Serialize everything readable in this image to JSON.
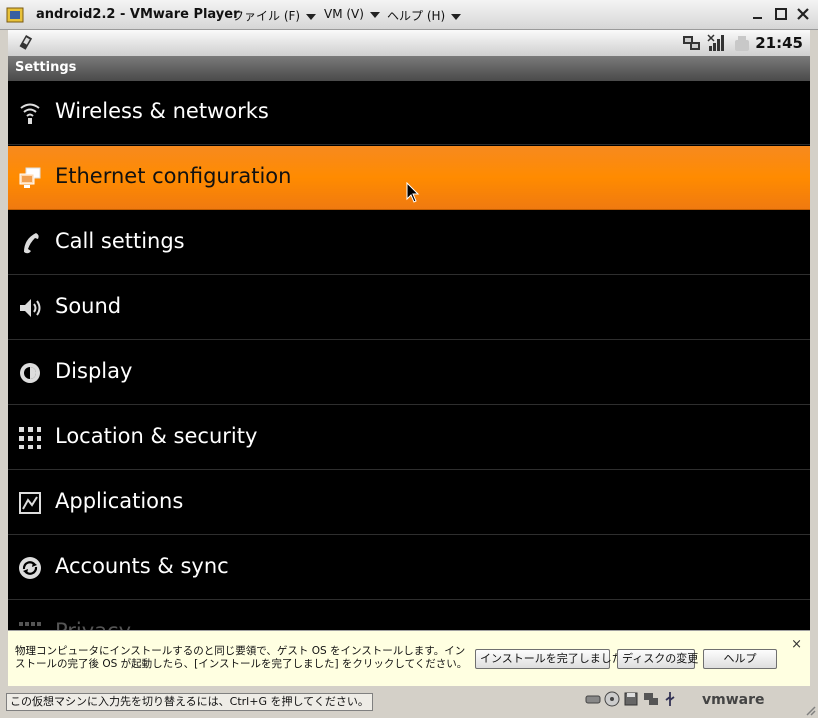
{
  "window": {
    "title": "android2.2 - VMware Player",
    "menus": [
      {
        "label": "ファイル (F)"
      },
      {
        "label": "VM (V)"
      },
      {
        "label": "ヘルプ (H)"
      }
    ]
  },
  "android": {
    "clock": "21:45",
    "header": "Settings",
    "items": [
      {
        "label": "Wireless & networks",
        "icon": "wifi-icon"
      },
      {
        "label": "Ethernet configuration",
        "icon": "ethernet-icon",
        "selected": true
      },
      {
        "label": "Call settings",
        "icon": "phone-icon"
      },
      {
        "label": "Sound",
        "icon": "speaker-icon"
      },
      {
        "label": "Display",
        "icon": "brightness-icon"
      },
      {
        "label": "Location & security",
        "icon": "grid-lock-icon"
      },
      {
        "label": "Applications",
        "icon": "apps-icon"
      },
      {
        "label": "Accounts & sync",
        "icon": "sync-icon"
      },
      {
        "label": "Privacy",
        "icon": "privacy-icon"
      }
    ]
  },
  "infobar": {
    "message": "物理コンピュータにインストールするのと同じ要領で、ゲスト OS をインストールします。インストールの完了後 OS が起動したら、[インストールを完了しました] をクリックしてください。",
    "buttons": {
      "finish": "インストールを完了しました",
      "change_disk": "ディスクの変更",
      "help": "ヘルプ"
    },
    "close": "×"
  },
  "statusbar": {
    "hint": "この仮想マシンに入力先を切り替えるには、Ctrl+G を押してください。",
    "logo": "vmware"
  },
  "colors": {
    "accent": "#ff8b00",
    "list_bg": "#000000",
    "infobar_bg": "#ffffe1"
  }
}
